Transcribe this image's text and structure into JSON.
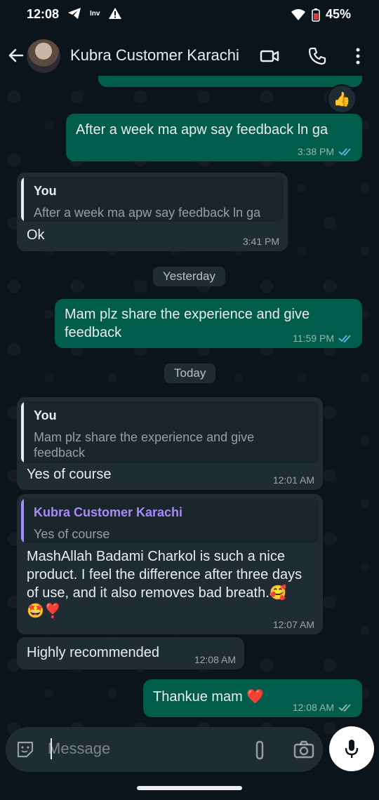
{
  "status_bar": {
    "time": "12:08",
    "mini_label": "Inv",
    "battery": "45%"
  },
  "header": {
    "contact_name": "Kubra  Customer Karachi"
  },
  "reaction": "👍",
  "messages": {
    "m1": {
      "text": "After a week ma apw say feedback ln ga",
      "time": "3:38 PM"
    },
    "m2": {
      "quote_name": "You",
      "quote_text": "After a week ma apw say feedback ln ga",
      "text": "Ok",
      "time": "3:41 PM"
    },
    "date1": "Yesterday",
    "m3": {
      "text": "Mam plz share the experience and give feedback",
      "time": "11:59 PM"
    },
    "date2": "Today",
    "m4": {
      "quote_name": "You",
      "quote_text": "Mam plz share the experience and give feedback",
      "text": "Yes of course",
      "time": "12:01 AM"
    },
    "m5": {
      "quote_name": "Kubra  Customer Karachi",
      "quote_text": "Yes of course",
      "text": "MashAllah Badami Charkol is such a nice product. I feel the difference after three days of use, and it also removes bad breath.🥰🤩❣️",
      "time": "12:07 AM"
    },
    "m6": {
      "text": "Highly recommended",
      "time": "12:08 AM"
    },
    "m7": {
      "text": "Thankue mam ❤️",
      "time": "12:08 AM"
    }
  },
  "composer": {
    "placeholder": "Message"
  },
  "colors": {
    "outgoing": "#005c4b",
    "incoming": "#202c33",
    "background": "#0b141a",
    "read_ticks": "#53bdeb"
  }
}
